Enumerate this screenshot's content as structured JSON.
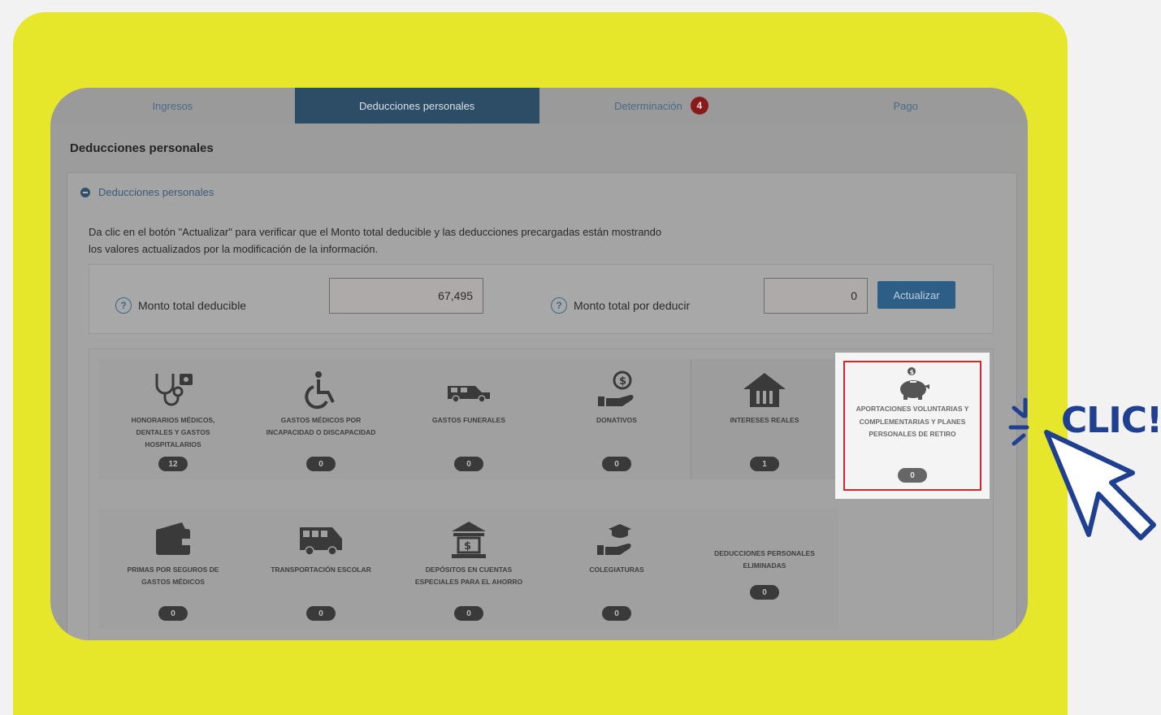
{
  "tabs": [
    {
      "label": "Ingresos",
      "active": false
    },
    {
      "label": "Deducciones personales",
      "active": true
    },
    {
      "label": "Determinación",
      "active": false,
      "badge": "4"
    },
    {
      "label": "Pago",
      "active": false
    }
  ],
  "section": {
    "title": "Deducciones personales"
  },
  "panel": {
    "header": "Deducciones personales",
    "info_line1": "Da clic en el botón \"Actualizar\" para verificar que el Monto total deducible y las deducciones precargadas están mostrando",
    "info_line2": "los valores actualizados por la modificación de la información."
  },
  "totals": {
    "deducible_label": "Monto total deducible",
    "deducible_value": "67,495",
    "por_deducir_label": "Monto total por deducir",
    "por_deducir_value": "0",
    "update_button": "Actualizar",
    "help_glyph": "?"
  },
  "cards": [
    {
      "label": "Honorarios médicos, dentales y gastos hospitalarios",
      "count": "12",
      "icon": "stethoscope-icon"
    },
    {
      "label": "Gastos médicos por incapacidad o discapacidad",
      "count": "0",
      "icon": "wheelchair-icon"
    },
    {
      "label": "Gastos funerales",
      "count": "0",
      "icon": "hearse-icon"
    },
    {
      "label": "Donativos",
      "count": "0",
      "icon": "donation-hand-icon"
    },
    {
      "label": "Intereses reales",
      "count": "1",
      "icon": "house-icon"
    },
    {
      "label": "Aportaciones voluntarias y complementarias y planes personales de retiro",
      "count": "0",
      "icon": "piggy-bank-icon"
    },
    {
      "label": "Primas por seguros de gastos médicos",
      "count": "0",
      "icon": "wallet-icon"
    },
    {
      "label": "Transportación escolar",
      "count": "0",
      "icon": "school-bus-icon"
    },
    {
      "label": "Depósitos en cuentas especiales para el ahorro",
      "count": "0",
      "icon": "bank-icon"
    },
    {
      "label": "Colegiaturas",
      "count": "0",
      "icon": "graduation-hand-icon"
    },
    {
      "label": "Deducciones personales eliminadas",
      "count": "0",
      "icon": ""
    }
  ],
  "callout": {
    "text": "CLIC!"
  },
  "colors": {
    "frame": "#e6e62a",
    "active_tab": "#2d4c66",
    "highlight_border": "#d8262f",
    "callout": "#1f3f91"
  }
}
